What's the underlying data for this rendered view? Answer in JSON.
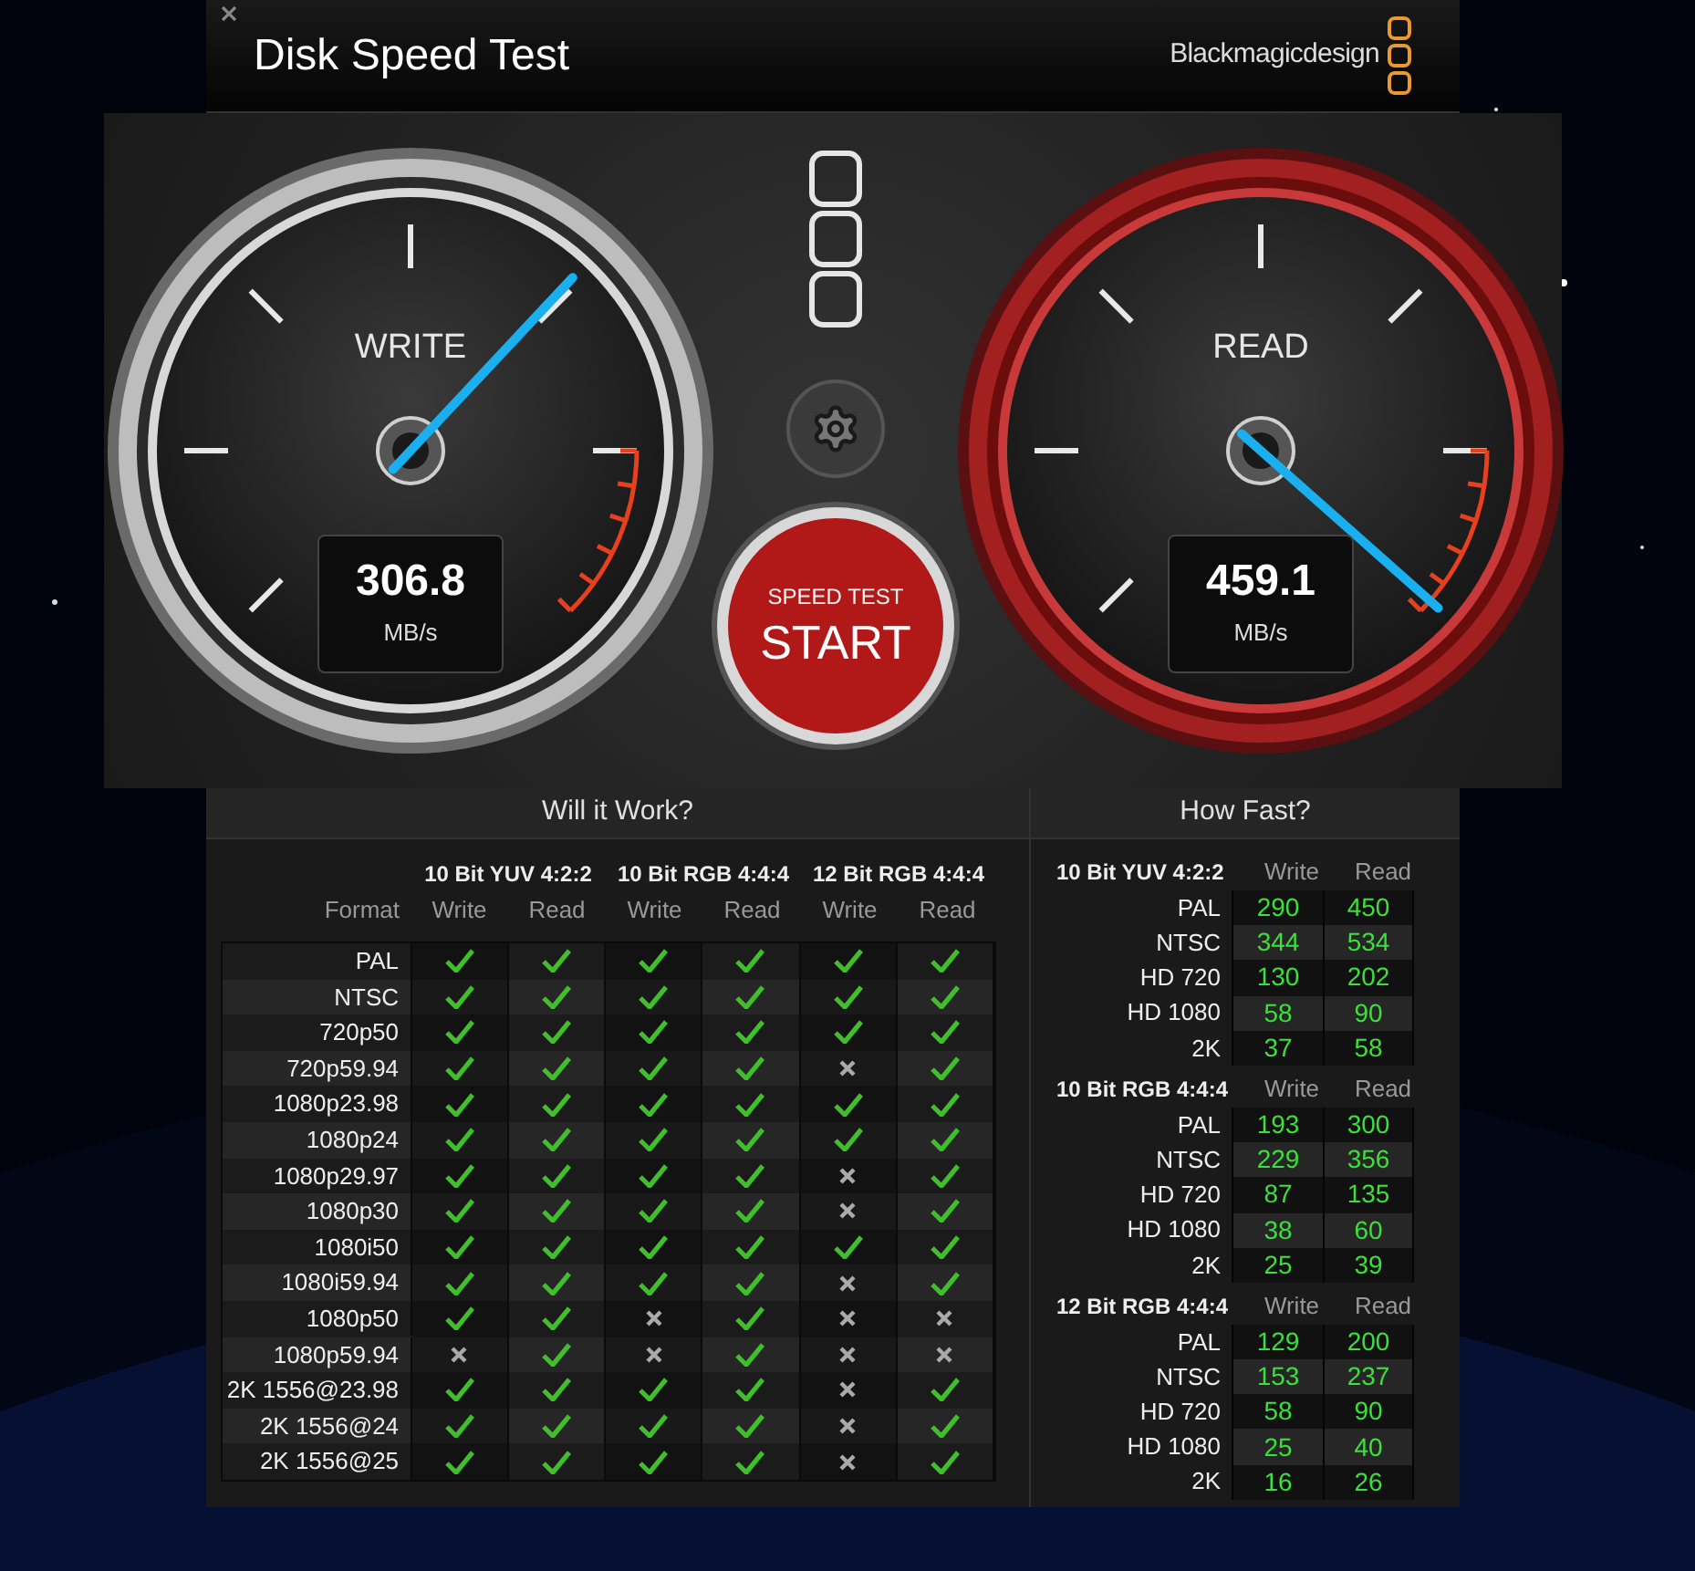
{
  "window": {
    "title": "Disk Speed Test",
    "brand": "Blackmagicdesign"
  },
  "gauges": [
    {
      "kind": "plain",
      "label": "WRITE",
      "value": "306.8",
      "unit": "MB/s"
    },
    {
      "kind": "hot",
      "label": "READ",
      "value": "459.1",
      "unit": "MB/s"
    }
  ],
  "start_button": {
    "caption": "SPEED TEST",
    "label": "START"
  },
  "will_it_work": {
    "title": "Will it Work?",
    "format_header": "Format",
    "groups": [
      {
        "name": "10 Bit YUV 4:2:2",
        "columns": [
          "Write",
          "Read"
        ]
      },
      {
        "name": "10 Bit RGB 4:4:4",
        "columns": [
          "Write",
          "Read"
        ]
      },
      {
        "name": "12 Bit RGB 4:4:4",
        "columns": [
          "Write",
          "Read"
        ]
      }
    ],
    "rows": [
      {
        "format": "PAL",
        "results": [
          true,
          true,
          true,
          true,
          true,
          true
        ]
      },
      {
        "format": "NTSC",
        "results": [
          true,
          true,
          true,
          true,
          true,
          true
        ]
      },
      {
        "format": "720p50",
        "results": [
          true,
          true,
          true,
          true,
          true,
          true
        ]
      },
      {
        "format": "720p59.94",
        "results": [
          true,
          true,
          true,
          true,
          false,
          true
        ]
      },
      {
        "format": "1080p23.98",
        "results": [
          true,
          true,
          true,
          true,
          true,
          true
        ]
      },
      {
        "format": "1080p24",
        "results": [
          true,
          true,
          true,
          true,
          true,
          true
        ]
      },
      {
        "format": "1080p29.97",
        "results": [
          true,
          true,
          true,
          true,
          false,
          true
        ]
      },
      {
        "format": "1080p30",
        "results": [
          true,
          true,
          true,
          true,
          false,
          true
        ]
      },
      {
        "format": "1080i50",
        "results": [
          true,
          true,
          true,
          true,
          true,
          true
        ]
      },
      {
        "format": "1080i59.94",
        "results": [
          true,
          true,
          true,
          true,
          false,
          true
        ]
      },
      {
        "format": "1080p50",
        "results": [
          true,
          true,
          false,
          true,
          false,
          false
        ]
      },
      {
        "format": "1080p59.94",
        "results": [
          false,
          true,
          false,
          true,
          false,
          false
        ]
      },
      {
        "format": "2K 1556@23.98",
        "results": [
          true,
          true,
          true,
          true,
          false,
          true
        ]
      },
      {
        "format": "2K 1556@24",
        "results": [
          true,
          true,
          true,
          true,
          false,
          true
        ]
      },
      {
        "format": "2K 1556@25",
        "results": [
          true,
          true,
          true,
          true,
          false,
          true
        ]
      }
    ]
  },
  "how_fast": {
    "title": "How Fast?",
    "groups": [
      {
        "name": "10 Bit YUV 4:2:2",
        "write_header": "Write",
        "read_header": "Read",
        "rows": [
          {
            "format": "PAL",
            "write": "290",
            "read": "450"
          },
          {
            "format": "NTSC",
            "write": "344",
            "read": "534"
          },
          {
            "format": "HD 720",
            "write": "130",
            "read": "202"
          },
          {
            "format": "HD 1080",
            "write": "58",
            "read": "90"
          },
          {
            "format": "2K",
            "write": "37",
            "read": "58"
          }
        ]
      },
      {
        "name": "10 Bit RGB 4:4:4",
        "write_header": "Write",
        "read_header": "Read",
        "rows": [
          {
            "format": "PAL",
            "write": "193",
            "read": "300"
          },
          {
            "format": "NTSC",
            "write": "229",
            "read": "356"
          },
          {
            "format": "HD 720",
            "write": "87",
            "read": "135"
          },
          {
            "format": "HD 1080",
            "write": "38",
            "read": "60"
          },
          {
            "format": "2K",
            "write": "25",
            "read": "39"
          }
        ]
      },
      {
        "name": "12 Bit RGB 4:4:4",
        "write_header": "Write",
        "read_header": "Read",
        "rows": [
          {
            "format": "PAL",
            "write": "129",
            "read": "200"
          },
          {
            "format": "NTSC",
            "write": "153",
            "read": "237"
          },
          {
            "format": "HD 720",
            "write": "58",
            "read": "90"
          },
          {
            "format": "HD 1080",
            "write": "25",
            "read": "40"
          },
          {
            "format": "2K",
            "write": "16",
            "read": "26"
          }
        ]
      }
    ]
  }
}
